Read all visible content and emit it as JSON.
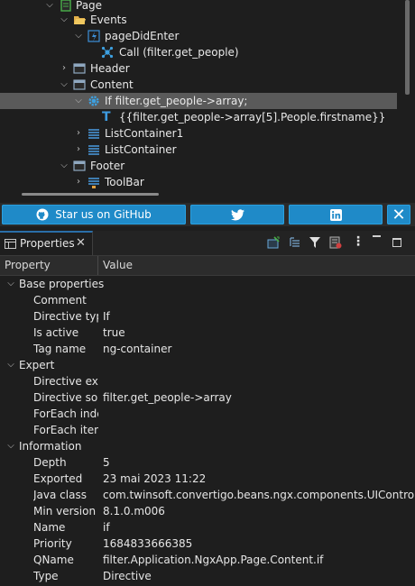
{
  "tree": {
    "rows": [
      {
        "label": "Page"
      },
      {
        "label": "Events"
      },
      {
        "label": "pageDidEnter"
      },
      {
        "label": "Call (filter.get_people)"
      },
      {
        "label": "Header"
      },
      {
        "label": "Content"
      },
      {
        "label": "If filter.get_people->array;"
      },
      {
        "label": "{{filter.get_people->array[5].People.firstname}}"
      },
      {
        "label": "ListContainer1"
      },
      {
        "label": "ListContainer"
      },
      {
        "label": "Footer"
      },
      {
        "label": "ToolBar"
      }
    ]
  },
  "buttons": {
    "github": "Star us on GitHub",
    "close_icon": "close-icon",
    "colors": {
      "button": "#1f8ac8"
    }
  },
  "properties": {
    "tab_title": "Properties",
    "header": {
      "property": "Property",
      "value": "Value"
    },
    "categories": {
      "base": "Base properties",
      "expert": "Expert",
      "information": "Information"
    },
    "base": [
      {
        "name": "Comment",
        "value": ""
      },
      {
        "name": "Directive type",
        "value": "If"
      },
      {
        "name": "Is active",
        "value": "true"
      },
      {
        "name": "Tag name",
        "value": "ng-container"
      }
    ],
    "expert": [
      {
        "name": "Directive expr",
        "value": ""
      },
      {
        "name": "Directive sour",
        "value": "filter.get_people->array"
      },
      {
        "name": "ForEach index",
        "value": ""
      },
      {
        "name": "ForEach item",
        "value": ""
      }
    ],
    "information": [
      {
        "name": "Depth",
        "value": "5"
      },
      {
        "name": "Exported",
        "value": "23 mai 2023 11:22"
      },
      {
        "name": "Java class",
        "value": "com.twinsoft.convertigo.beans.ngx.components.UIControlDirect"
      },
      {
        "name": "Min version",
        "value": "8.1.0.m006"
      },
      {
        "name": "Name",
        "value": "if"
      },
      {
        "name": "Priority",
        "value": "1684833666385"
      },
      {
        "name": "QName",
        "value": "filter.Application.NgxApp.Page.Content.if"
      },
      {
        "name": "Type",
        "value": "Directive"
      }
    ]
  }
}
